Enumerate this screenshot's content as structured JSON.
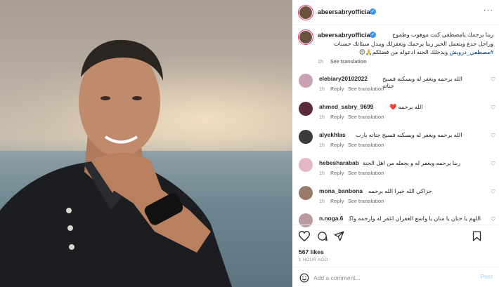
{
  "post": {
    "author": "abeersabryofficial",
    "caption_lines": [
      "ربنا يرحمك يامصطفي كنت موهوب وطموح",
      "وراجل جدع وبتعمل الخير ربنا يرحمك ويغفرلك ويبدل سيئاتك حسنات",
      "ويدخلك الجنه ادعوله من فضلكم🙏😔"
    ],
    "hashtag": "#مصطفي_درويش",
    "caption_time": "1h",
    "see_translation": "See translation",
    "likes": "567 likes",
    "ago": "1 HOUR AGO"
  },
  "comments": [
    {
      "user": "elebiary20102022",
      "text": "الله يرحمه ويغفر له ويسكنه فسيح جناته",
      "time": "1h",
      "reply": "Reply",
      "translate": "See translation",
      "avatar_color": "#c9a1b5"
    },
    {
      "user": "ahmed_sabry_9699",
      "text": "الله يرحمه ❤️",
      "time": "1h",
      "reply": "Reply",
      "translate": "See translation",
      "avatar_color": "#5a2a3a"
    },
    {
      "user": "alyekhlas",
      "text": "الله يرحمه ويغفر له ويسكنه فسيح جناته يارب",
      "time": "1h",
      "reply": "Reply",
      "translate": "See translation",
      "avatar_color": "#3a3a3a"
    },
    {
      "user": "hebesharabab",
      "text": "ربنا يرحمه ويغفر له و يجعله من اهل الجنة",
      "time": "1h",
      "reply": "Reply",
      "translate": "See translation",
      "avatar_color": "#e3b7c4"
    },
    {
      "user": "mona_banbona",
      "text": "جزاكي الله خيرا الله يرحمه",
      "time": "1h",
      "reply": "Reply",
      "translate": "See translation",
      "avatar_color": "#9a7a6a"
    },
    {
      "user": "n.noga.6",
      "text": "اللهم يا حنان يا منان يا واسع الغفران اغفر له وارحمه واكرم",
      "time": "",
      "reply": "",
      "translate": "",
      "avatar_color": "#b89aa0"
    }
  ],
  "add_comment": {
    "placeholder": "Add a comment...",
    "post_label": "Post"
  },
  "colors": {
    "verified": "#3897f0",
    "link": "#00376b",
    "muted": "#8e8e8e",
    "text": "#262626"
  },
  "icons": [
    "more-options-icon",
    "verified-badge-icon",
    "heart-icon",
    "comment-icon",
    "share-icon",
    "save-icon",
    "emoji-icon"
  ]
}
